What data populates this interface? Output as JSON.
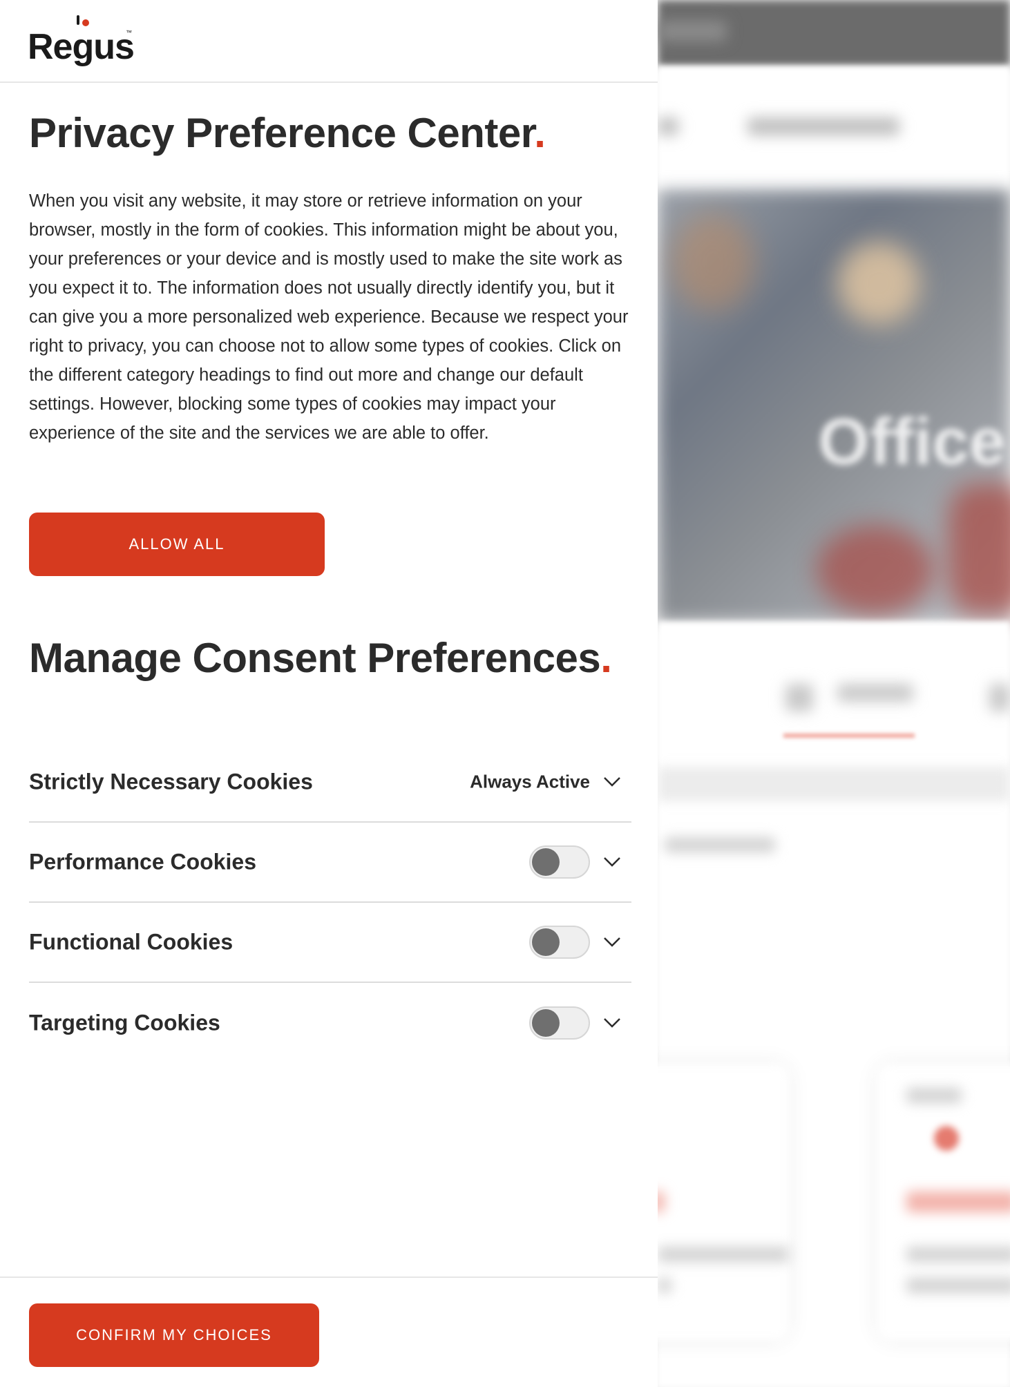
{
  "logo": {
    "text": "Regus",
    "tm": "™"
  },
  "header": {
    "title": "Privacy Preference Center",
    "title_dot": "."
  },
  "description": "When you visit any website, it may store or retrieve information on your browser, mostly in the form of cookies. This information might be about you, your preferences or your device and is mostly used to make the site work as you expect it to. The information does not usually directly identify you, but it can give you a more personalized web experience. Because we respect your right to privacy, you can choose not to allow some types of cookies. Click on the different category headings to find out more and change our default settings. However, blocking some types of cookies may impact your experience of the site and the services we are able to offer.",
  "allow_all_label": "ALLOW ALL",
  "manage": {
    "title": "Manage Consent Preferences",
    "title_dot": "."
  },
  "categories": [
    {
      "label": "Strictly Necessary Cookies",
      "status": "Always Active"
    },
    {
      "label": "Performance Cookies",
      "enabled": false
    },
    {
      "label": "Functional Cookies",
      "enabled": false
    },
    {
      "label": "Targeting Cookies",
      "enabled": false
    }
  ],
  "confirm_label": "CONFIRM MY CHOICES",
  "background": {
    "hero_word": "Office"
  },
  "colors": {
    "accent": "#d63a1f",
    "text": "#2b2b2b",
    "toggle_knob": "#6f6f6f"
  },
  "icons": {
    "expand": "chevron-down-icon",
    "logo_mark": "regus-logo-mark"
  }
}
